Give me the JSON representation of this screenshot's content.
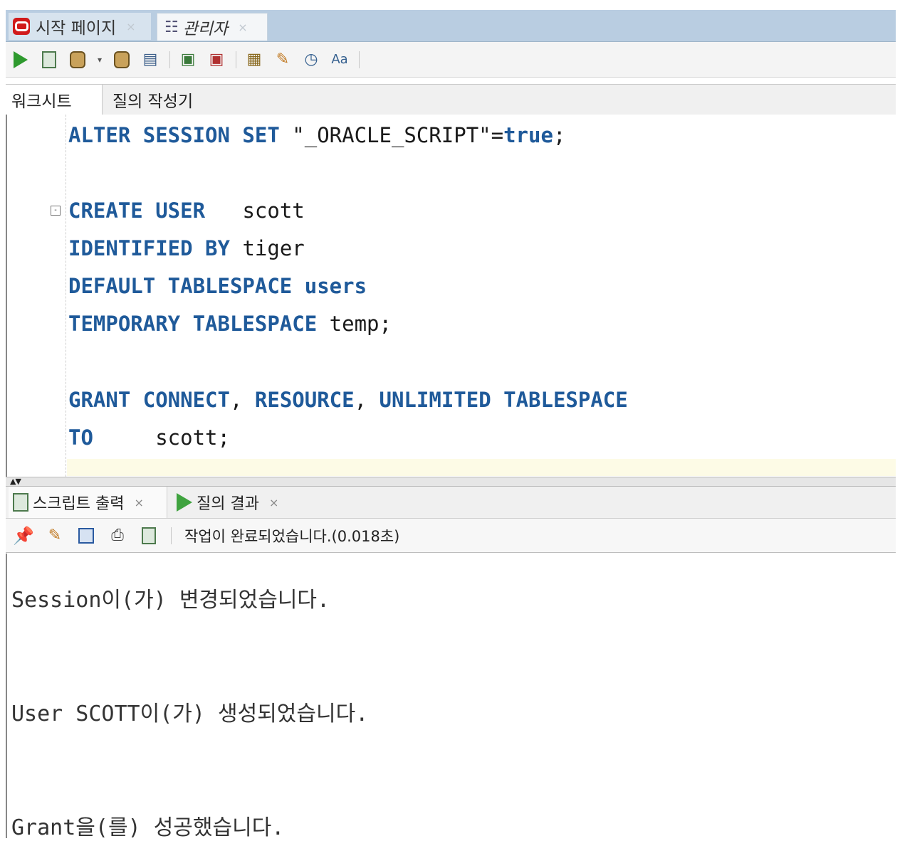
{
  "top_tabs": [
    {
      "label": "시작 페이지",
      "close": "×"
    },
    {
      "label": "관리자",
      "close": "×"
    }
  ],
  "worksheet_tabs": [
    "워크시트",
    "질의 작성기"
  ],
  "editor": {
    "line1": {
      "kw1": "ALTER SESSION SET",
      "str": " \"_ORACLE_SCRIPT\"=",
      "kw2": "true",
      "end": ";"
    },
    "line2": {
      "kw": "CREATE USER",
      "rest": "   scott"
    },
    "line3": {
      "kw": "IDENTIFIED BY",
      "rest": " tiger"
    },
    "line4": {
      "kw": "DEFAULT TABLESPACE users",
      "rest": ""
    },
    "line5": {
      "kw": "TEMPORARY TABLESPACE",
      "rest": " temp;"
    },
    "line6": {
      "kw1": "GRANT CONNECT",
      "sep1": ", ",
      "kw2": "RESOURCE",
      "sep2": ", ",
      "kw3": "UNLIMITED TABLESPACE"
    },
    "line7": {
      "kw": "TO",
      "rest": "     scott;"
    }
  },
  "output_tabs": [
    {
      "label": "스크립트 출력",
      "close": "×"
    },
    {
      "label": "질의 결과",
      "close": "×"
    }
  ],
  "status": "작업이 완료되었습니다.(0.018초)",
  "output_lines": [
    "Session이(가) 변경되었습니다.",
    "User SCOTT이(가) 생성되었습니다.",
    "Grant을(를) 성공했습니다."
  ]
}
